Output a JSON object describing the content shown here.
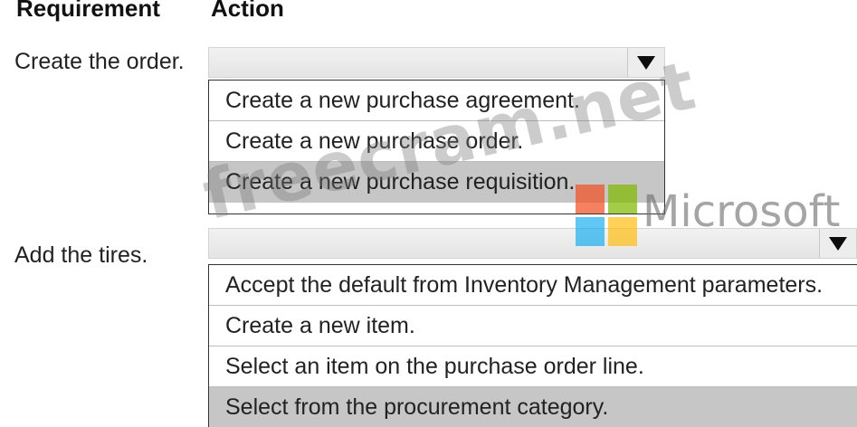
{
  "headers": {
    "requirement": "Requirement",
    "action": "Action"
  },
  "rows": [
    {
      "requirement": "Create the order.",
      "selected_value": "",
      "options": [
        "Create a new purchase agreement.",
        "Create a new purchase order.",
        "Create a new purchase requisition."
      ],
      "highlighted_index": 2
    },
    {
      "requirement": "Add the tires.",
      "selected_value": "",
      "options": [
        "Accept the default from Inventory Management parameters.",
        "Create a new item.",
        "Select an item on the purchase order line.",
        "Select from the procurement category."
      ],
      "highlighted_index": 3
    }
  ],
  "watermark": {
    "site": "freecram.net",
    "brand": "Microsoft",
    "logo_colors": [
      "#f25022",
      "#7fba00",
      "#00a4ef",
      "#ffb900"
    ]
  },
  "icons": {
    "dropdown_arrow": "chevron-down-icon"
  }
}
